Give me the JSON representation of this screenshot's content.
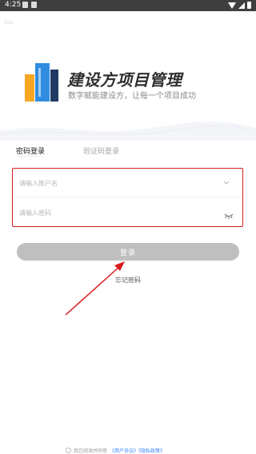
{
  "status_bar": {
    "time": "4:25",
    "icons_left": [
      "image-icon",
      "notification-icon"
    ],
    "icons_right": [
      "wifi-icon",
      "signal-icon",
      "battery-icon"
    ]
  },
  "app": {
    "faint_label": "ZJSZ",
    "title": "建设方项目管理",
    "slogan": "数字赋能建设方，让每一个项目成功",
    "logo_colors": {
      "blue": "#2f8ce0",
      "orange": "#f5a623",
      "dark": "#1f3a63"
    }
  },
  "tabs": [
    {
      "label": "密码登录",
      "active": true
    },
    {
      "label": "验证码登录",
      "active": false
    }
  ],
  "form": {
    "account_placeholder": "请输入账户名",
    "account_value": "",
    "password_placeholder": "请输入密码",
    "password_value": "",
    "highlight_color": "#d61b1b"
  },
  "login_button": {
    "label": "登录",
    "color": "#bfbfbf"
  },
  "forgot_password": "忘记密码",
  "agreement": {
    "text": "我已阅读并同意",
    "links": "《用户协议》《隐私政策》"
  },
  "annotation": {
    "color": "#d61b1b"
  }
}
